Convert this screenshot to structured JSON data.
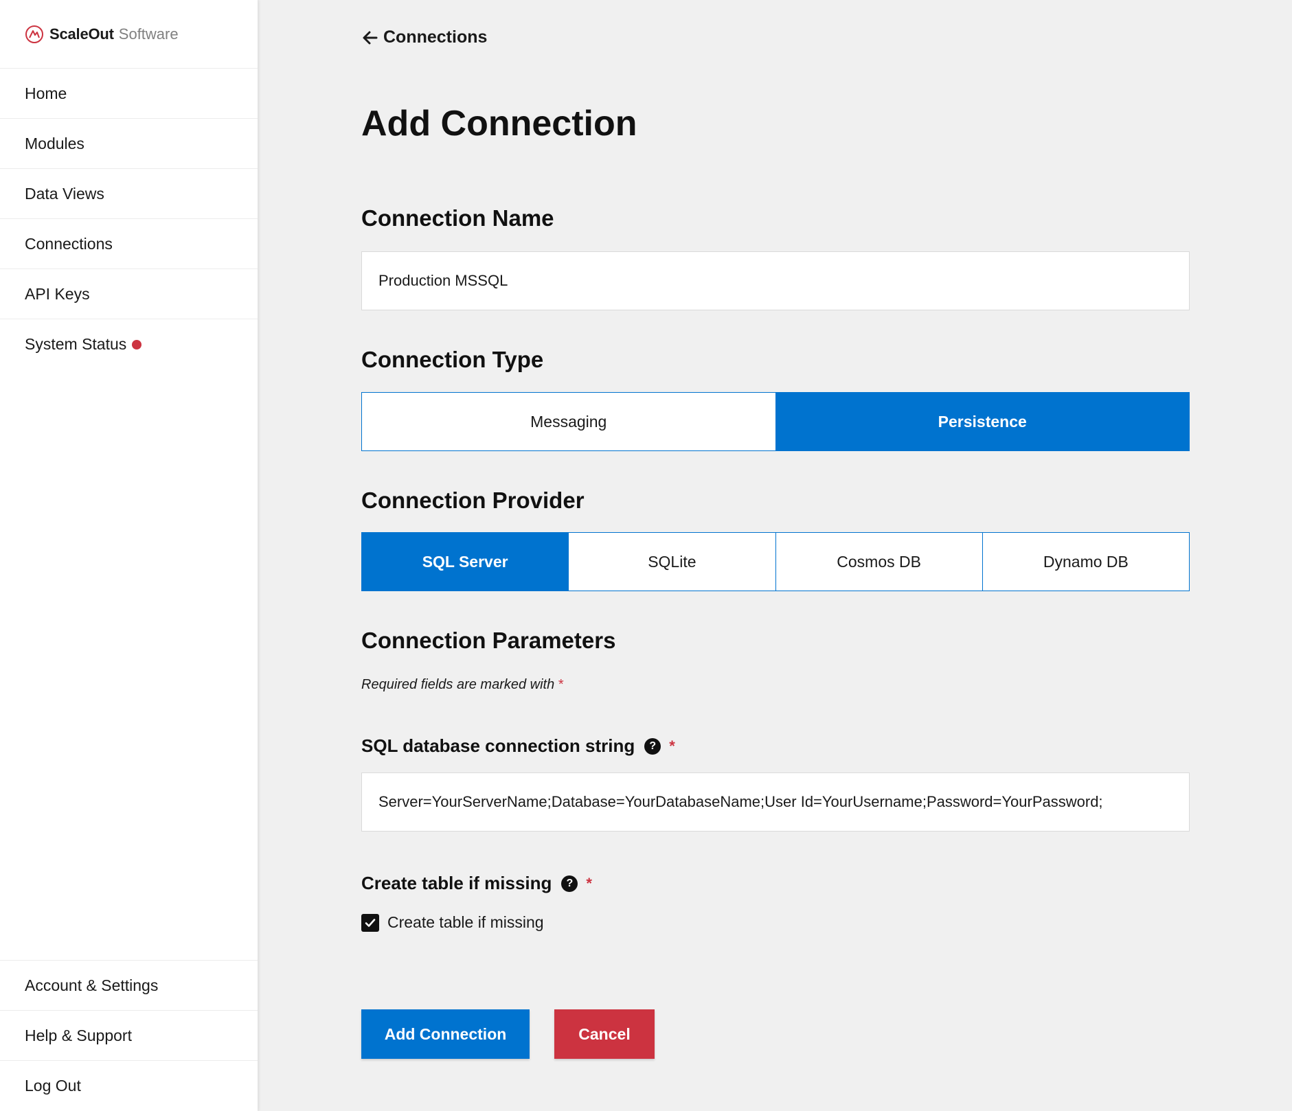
{
  "brand": {
    "name": "ScaleOut",
    "suffix": "Software"
  },
  "sidebar": {
    "items": [
      {
        "label": "Home"
      },
      {
        "label": "Modules"
      },
      {
        "label": "Data Views"
      },
      {
        "label": "Connections"
      },
      {
        "label": "API Keys"
      },
      {
        "label": "System Status"
      }
    ],
    "bottom_items": [
      {
        "label": "Account & Settings"
      },
      {
        "label": "Help & Support"
      },
      {
        "label": "Log Out"
      }
    ],
    "status_color": "#cc3340"
  },
  "header": {
    "back_label": "Connections",
    "title": "Add Connection"
  },
  "connection_name": {
    "title": "Connection Name",
    "value": "Production MSSQL"
  },
  "connection_type": {
    "title": "Connection Type",
    "options": [
      "Messaging",
      "Persistence"
    ],
    "selected": "Persistence"
  },
  "connection_provider": {
    "title": "Connection Provider",
    "options": [
      "SQL Server",
      "SQLite",
      "Cosmos DB",
      "Dynamo DB"
    ],
    "selected": "SQL Server"
  },
  "connection_parameters": {
    "title": "Connection Parameters",
    "required_note": "Required fields are marked with",
    "required_marker": "*",
    "connection_string": {
      "label": "SQL database connection string",
      "value": "Server=YourServerName;Database=YourDatabaseName;User Id=YourUsername;Password=YourPassword;"
    },
    "create_table": {
      "label": "Create table if missing",
      "checkbox_label": "Create table if missing",
      "checked": true
    }
  },
  "actions": {
    "submit_label": "Add Connection",
    "cancel_label": "Cancel"
  },
  "colors": {
    "accent": "#0073cf",
    "danger": "#cc3340",
    "background": "#f0f0f0"
  }
}
